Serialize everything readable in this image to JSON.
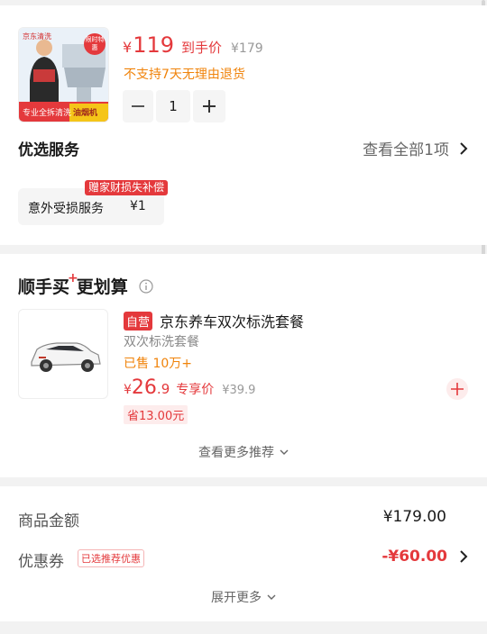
{
  "product": {
    "image_brand_text": "京东清洗",
    "image_badge": "限时特惠",
    "image_banner": "专业全拆清洗",
    "image_category": "油烟机",
    "currency": "¥",
    "price": "119",
    "price_label": "到手价",
    "original_price": "¥179",
    "return_policy": "不支持7天无理由退货",
    "quantity": "1"
  },
  "services": {
    "title": "优选服务",
    "view_all": "查看全部1项",
    "gift_tag": "赠家财损失补偿",
    "item_label": "意外受损服务",
    "item_price": "¥1"
  },
  "addon": {
    "title_part1": "顺手买",
    "title_part2": "更划算",
    "item": {
      "badge": "自营",
      "name": "京东养车双次标洗套餐",
      "spec": "双次标洗套餐",
      "sold": "已售 10万+",
      "currency": "¥",
      "price_int": "26",
      "price_dec": ".9",
      "price_label": "专享价",
      "original_price": "¥39.9",
      "saving": "省13.00元"
    },
    "more_link": "查看更多推荐"
  },
  "summary": {
    "goods_label": "商品金额",
    "goods_value": "¥179.00",
    "coupon_label": "优惠券",
    "coupon_tag": "已选推荐优惠",
    "coupon_value": "-¥60.00",
    "expand": "展开更多"
  },
  "colors": {
    "accent": "#e4393c",
    "orange": "#f0830a",
    "background": "#f2f2f2"
  }
}
